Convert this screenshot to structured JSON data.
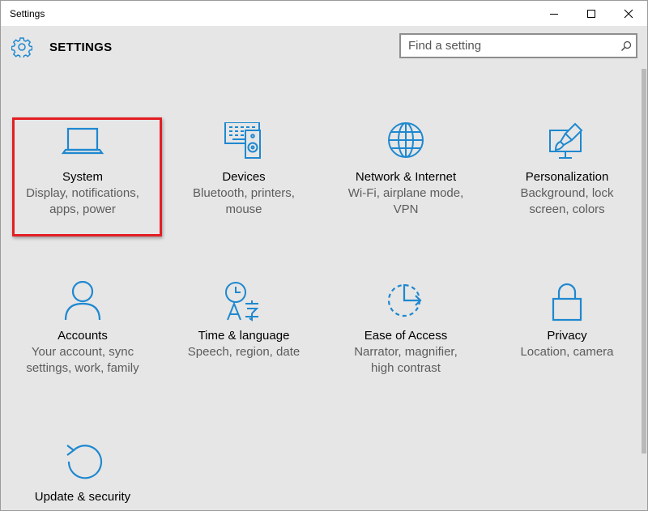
{
  "window": {
    "title": "Settings"
  },
  "header": {
    "title": "SETTINGS"
  },
  "search": {
    "placeholder": "Find a setting"
  },
  "colors": {
    "accent": "#1e88d0",
    "highlight": "#e31e24"
  },
  "tiles": [
    {
      "title": "System",
      "desc1": "Display, notifications,",
      "desc2": "apps, power",
      "icon": "laptop-icon"
    },
    {
      "title": "Devices",
      "desc1": "Bluetooth, printers,",
      "desc2": "mouse",
      "icon": "devices-icon"
    },
    {
      "title": "Network & Internet",
      "desc1": "Wi-Fi, airplane mode,",
      "desc2": "VPN",
      "icon": "globe-icon"
    },
    {
      "title": "Personalization",
      "desc1": "Background, lock",
      "desc2": "screen, colors",
      "icon": "paintbrush-icon"
    },
    {
      "title": "Accounts",
      "desc1": "Your account, sync",
      "desc2": "settings, work, family",
      "icon": "person-icon"
    },
    {
      "title": "Time & language",
      "desc1": "Speech, region, date",
      "desc2": "",
      "icon": "clock-language-icon"
    },
    {
      "title": "Ease of Access",
      "desc1": "Narrator, magnifier,",
      "desc2": "high contrast",
      "icon": "ease-of-access-icon"
    },
    {
      "title": "Privacy",
      "desc1": "Location, camera",
      "desc2": "",
      "icon": "lock-icon"
    },
    {
      "title": "Update & security",
      "desc1": "",
      "desc2": "",
      "icon": "refresh-icon"
    }
  ]
}
